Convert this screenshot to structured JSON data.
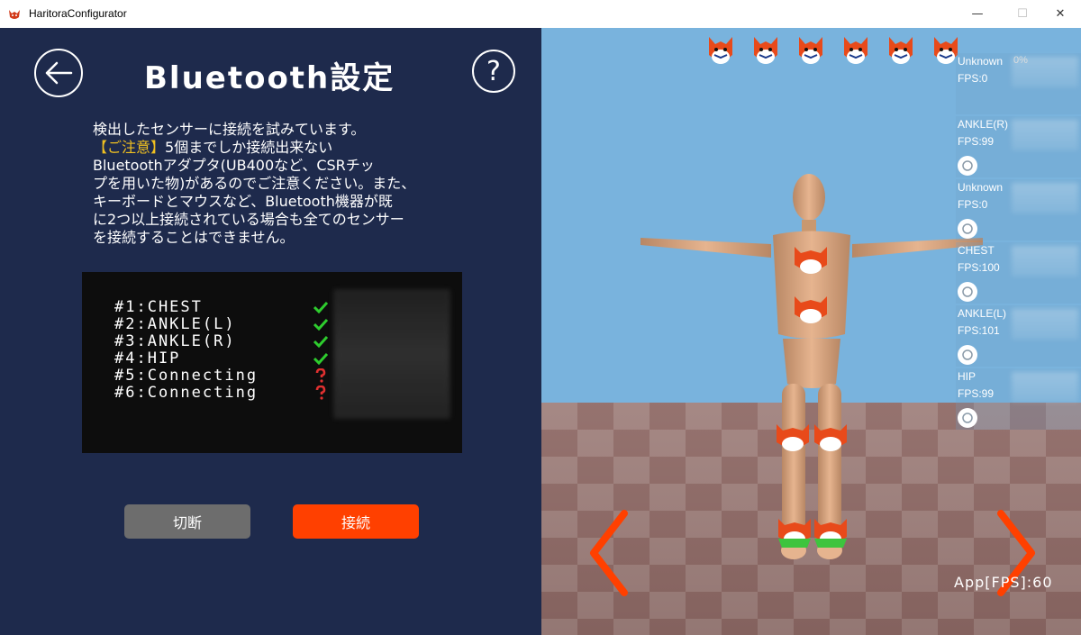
{
  "window": {
    "title": "HaritoraConfigurator",
    "minimize": "—",
    "maximize": "☐",
    "close": "✕"
  },
  "left_panel": {
    "title": "Bluetooth設定",
    "help_symbol": "?",
    "description": {
      "line1": "検出したセンサーに接続を試みています。",
      "warning_label": "【ご注意】",
      "line2_rest": "5個までしか接続出来ない",
      "line3": "Bluetoothアダプタ(UB400など、CSRチッ",
      "line4": "プを用いた物)があるのでご注意ください。また、",
      "line5": "キーボードとマウスなど、Bluetooth機器が既",
      "line6": "に2つ以上接続されている場合も全てのセンサー",
      "line7": "を接続することはできません。"
    },
    "sensors": [
      {
        "label": "#1:CHEST",
        "status": "check-icon"
      },
      {
        "label": "#2:ANKLE(L)",
        "status": "check-icon"
      },
      {
        "label": "#3:ANKLE(R)",
        "status": "check-icon"
      },
      {
        "label": "#4:HIP",
        "status": "check-icon"
      },
      {
        "label": "#5:Connecting",
        "status": "question-icon"
      },
      {
        "label": "#6:Connecting",
        "status": "question-icon"
      }
    ],
    "buttons": {
      "disconnect": "切断",
      "connect": "接続"
    }
  },
  "viewport": {
    "devices": [
      {
        "name": "Unknown",
        "fps": "FPS:0",
        "battery": "0%",
        "has_battery_icon": false
      },
      {
        "name": "ANKLE(R)",
        "fps": "FPS:99",
        "has_battery_icon": true
      },
      {
        "name": "Unknown",
        "fps": "FPS:0",
        "has_battery_icon": true
      },
      {
        "name": "CHEST",
        "fps": "FPS:100",
        "has_battery_icon": true
      },
      {
        "name": "ANKLE(L)",
        "fps": "FPS:101",
        "has_battery_icon": true
      },
      {
        "name": "HIP",
        "fps": "FPS:99",
        "has_battery_icon": true
      }
    ],
    "app_fps": "App[FPS]:60"
  },
  "colors": {
    "panel_bg": "#1e2a4c",
    "accent": "#ff4000",
    "warning": "#f0c020",
    "sky": "#79b3dd"
  }
}
